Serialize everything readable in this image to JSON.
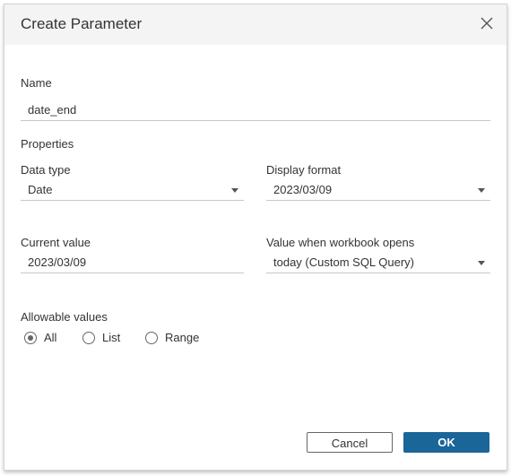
{
  "dialog": {
    "title": "Create Parameter",
    "close_icon": "close-icon"
  },
  "name": {
    "label": "Name",
    "value": "date_end"
  },
  "properties": {
    "heading": "Properties",
    "data_type": {
      "label": "Data type",
      "value": "Date"
    },
    "display_format": {
      "label": "Display format",
      "value": "2023/03/09"
    },
    "current_value": {
      "label": "Current value",
      "value": "2023/03/09"
    },
    "value_when_opens": {
      "label": "Value when workbook opens",
      "value": "today (Custom SQL Query)"
    }
  },
  "allowable": {
    "label": "Allowable values",
    "options": [
      "All",
      "List",
      "Range"
    ],
    "selected": "All"
  },
  "buttons": {
    "cancel": "Cancel",
    "ok": "OK",
    "ok_color": "#1a6699"
  }
}
